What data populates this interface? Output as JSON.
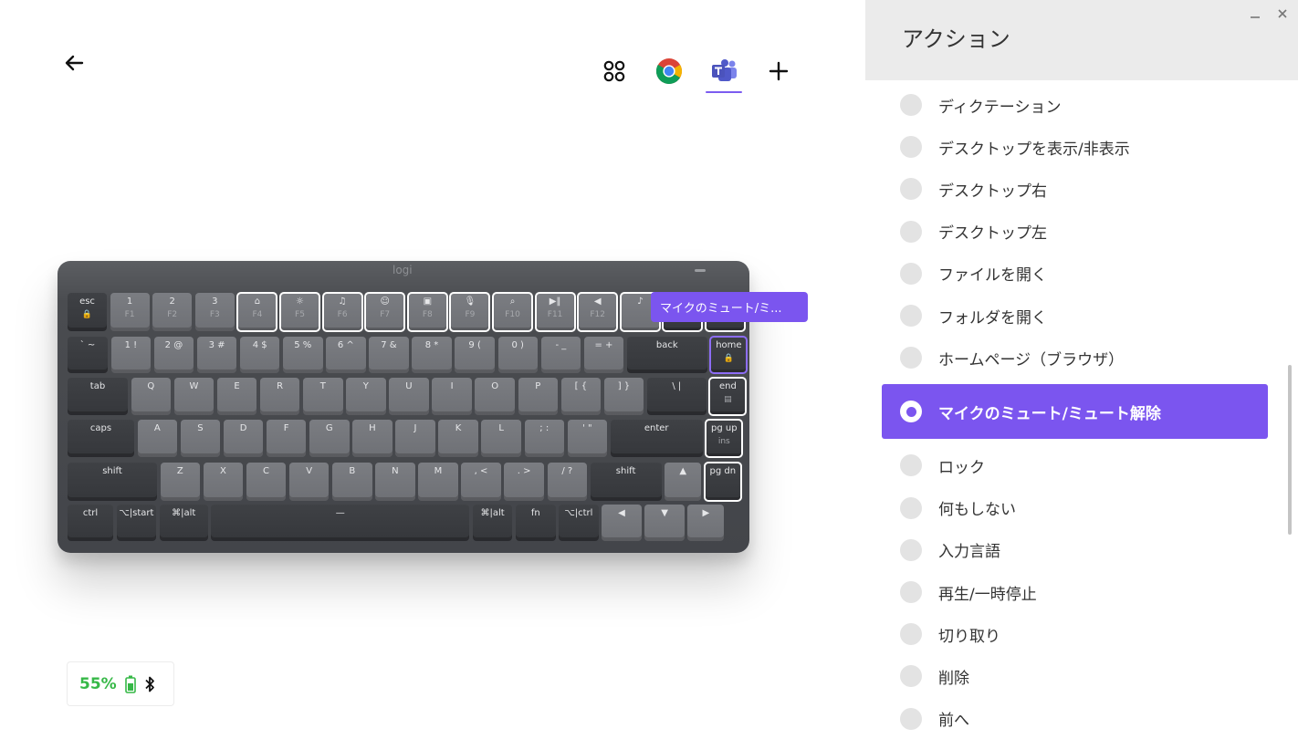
{
  "header": {
    "back_label": "←",
    "apps": [
      {
        "name": "all-apps",
        "icon": "grid-icon"
      },
      {
        "name": "chrome",
        "icon": "chrome-icon"
      },
      {
        "name": "teams",
        "icon": "teams-icon",
        "active": true
      },
      {
        "name": "add",
        "icon": "plus-icon"
      }
    ],
    "accent_color": "#7b55ef"
  },
  "keyboard": {
    "logo": "logi",
    "rows": [
      [
        [
          "esc",
          "🔒"
        ],
        [
          "1",
          "F1"
        ],
        [
          "2",
          "F2"
        ],
        [
          "3",
          "F3"
        ],
        [
          "⌂",
          "F4"
        ],
        [
          "☼",
          "F5"
        ],
        [
          "♫",
          "F6"
        ],
        [
          "☺",
          "F7"
        ],
        [
          "▣",
          "F8"
        ],
        [
          "🎙",
          "F9"
        ],
        [
          "⌕",
          "F10"
        ],
        [
          "▶‖",
          "F11"
        ],
        [
          "◀",
          "F12"
        ],
        [
          "♪",
          ""
        ],
        [
          "",
          ""
        ],
        [
          "",
          ""
        ]
      ],
      [
        [
          "` ~",
          ""
        ],
        [
          "1 !",
          ""
        ],
        [
          "2 @",
          ""
        ],
        [
          "3 #",
          ""
        ],
        [
          "4 $",
          ""
        ],
        [
          "5 %",
          ""
        ],
        [
          "6 ^",
          ""
        ],
        [
          "7 &",
          ""
        ],
        [
          "8 *",
          ""
        ],
        [
          "9 (",
          ""
        ],
        [
          "0 )",
          ""
        ],
        [
          "- _",
          ""
        ],
        [
          "= +",
          ""
        ],
        [
          "back",
          ""
        ],
        [
          "home",
          "🔒"
        ]
      ],
      [
        [
          "tab",
          ""
        ],
        [
          "Q",
          ""
        ],
        [
          "W",
          ""
        ],
        [
          "E",
          ""
        ],
        [
          "R",
          ""
        ],
        [
          "T",
          ""
        ],
        [
          "Y",
          ""
        ],
        [
          "U",
          ""
        ],
        [
          "I",
          ""
        ],
        [
          "O",
          ""
        ],
        [
          "P",
          ""
        ],
        [
          "[ {",
          ""
        ],
        [
          "] }",
          ""
        ],
        [
          "\\ |",
          ""
        ],
        [
          "end",
          "▤"
        ]
      ],
      [
        [
          "caps",
          ""
        ],
        [
          "A",
          ""
        ],
        [
          "S",
          ""
        ],
        [
          "D",
          ""
        ],
        [
          "F",
          ""
        ],
        [
          "G",
          ""
        ],
        [
          "H",
          ""
        ],
        [
          "J",
          ""
        ],
        [
          "K",
          ""
        ],
        [
          "L",
          ""
        ],
        [
          "; :",
          ""
        ],
        [
          "' \"",
          ""
        ],
        [
          "enter",
          ""
        ],
        [
          "pg up",
          "ins"
        ]
      ],
      [
        [
          "shift",
          ""
        ],
        [
          "Z",
          ""
        ],
        [
          "X",
          ""
        ],
        [
          "C",
          ""
        ],
        [
          "V",
          ""
        ],
        [
          "B",
          ""
        ],
        [
          "N",
          ""
        ],
        [
          "M",
          ""
        ],
        [
          ", <",
          ""
        ],
        [
          ". >",
          ""
        ],
        [
          "/ ?",
          ""
        ],
        [
          "shift",
          ""
        ],
        [
          "▲",
          ""
        ],
        [
          "pg dn",
          ""
        ]
      ],
      [
        [
          "ctrl",
          ""
        ],
        [
          "⌥|start",
          ""
        ],
        [
          "⌘|alt",
          ""
        ],
        [
          "—",
          ""
        ],
        [
          "⌘|alt",
          ""
        ],
        [
          "fn",
          ""
        ],
        [
          "⌥|ctrl",
          ""
        ],
        [
          "◀",
          ""
        ],
        [
          "▼",
          ""
        ],
        [
          "▶",
          ""
        ]
      ]
    ],
    "tooltip": "マイクのミュート/ミ..."
  },
  "battery": {
    "percent": "55%",
    "color": "#36b847"
  },
  "panel": {
    "title": "アクション",
    "actions": [
      {
        "label": "ディクテーション",
        "selected": false
      },
      {
        "label": "デスクトップを表示/非表示",
        "selected": false
      },
      {
        "label": "デスクトップ右",
        "selected": false
      },
      {
        "label": "デスクトップ左",
        "selected": false
      },
      {
        "label": "ファイルを開く",
        "selected": false
      },
      {
        "label": "フォルダを開く",
        "selected": false
      },
      {
        "label": "ホームページ（ブラウザ）",
        "selected": false
      },
      {
        "label": "マイクのミュート/ミュート解除",
        "selected": true
      },
      {
        "label": "ロック",
        "selected": false
      },
      {
        "label": "何もしない",
        "selected": false
      },
      {
        "label": "入力言語",
        "selected": false
      },
      {
        "label": "再生/一時停止",
        "selected": false
      },
      {
        "label": "切り取り",
        "selected": false
      },
      {
        "label": "削除",
        "selected": false
      },
      {
        "label": "前へ",
        "selected": false
      }
    ]
  }
}
